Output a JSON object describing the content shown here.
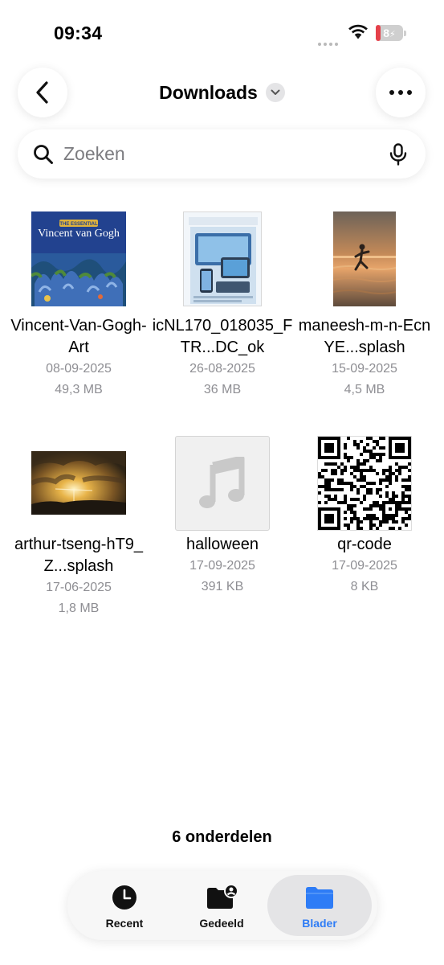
{
  "status_bar": {
    "time": "09:34",
    "battery_level": "8",
    "battery_percent": 8
  },
  "header": {
    "title": "Downloads",
    "back_icon": "chevron-left-icon",
    "menu_icon": "ellipsis-icon",
    "title_menu_icon": "chevron-down-icon"
  },
  "search": {
    "placeholder": "Zoeken",
    "value": "",
    "icon": "magnifier-icon",
    "mic_icon": "microphone-icon"
  },
  "files": [
    {
      "name": "Vincent-Van-Gogh-Art",
      "date": "08-09-2025",
      "size": "49,3 MB",
      "thumbnail": "book-cover-van-gogh",
      "cover_title_small": "THE ESSENTIAL",
      "cover_title": "Vincent van Gogh"
    },
    {
      "name": "icNL170_018035_FTR...DC_ok",
      "date": "26-08-2025",
      "size": "36 MB",
      "thumbnail": "document-page-devices"
    },
    {
      "name": "maneesh-m-n-EcnYE...splash",
      "date": "15-09-2025",
      "size": "4,5 MB",
      "thumbnail": "photo-beach-sunset"
    },
    {
      "name": "arthur-tseng-hT9_Z...splash",
      "date": "17-06-2025",
      "size": "1,8 MB",
      "thumbnail": "photo-sunset-clouds"
    },
    {
      "name": "halloween",
      "date": "17-09-2025",
      "size": "391 KB",
      "thumbnail": "music-note-icon"
    },
    {
      "name": "qr-code",
      "date": "17-09-2025",
      "size": "8 KB",
      "thumbnail": "qr-code-image"
    }
  ],
  "footer": {
    "item_count": "6 onderdelen"
  },
  "tabs": [
    {
      "label": "Recent",
      "icon": "clock-icon",
      "active": false
    },
    {
      "label": "Gedeeld",
      "icon": "shared-folder-icon",
      "active": false
    },
    {
      "label": "Blader",
      "icon": "folder-icon",
      "active": true
    }
  ],
  "colors": {
    "accent": "#2e7cf6",
    "secondary_text": "#8e8e93",
    "battery_low": "#e5404a"
  }
}
